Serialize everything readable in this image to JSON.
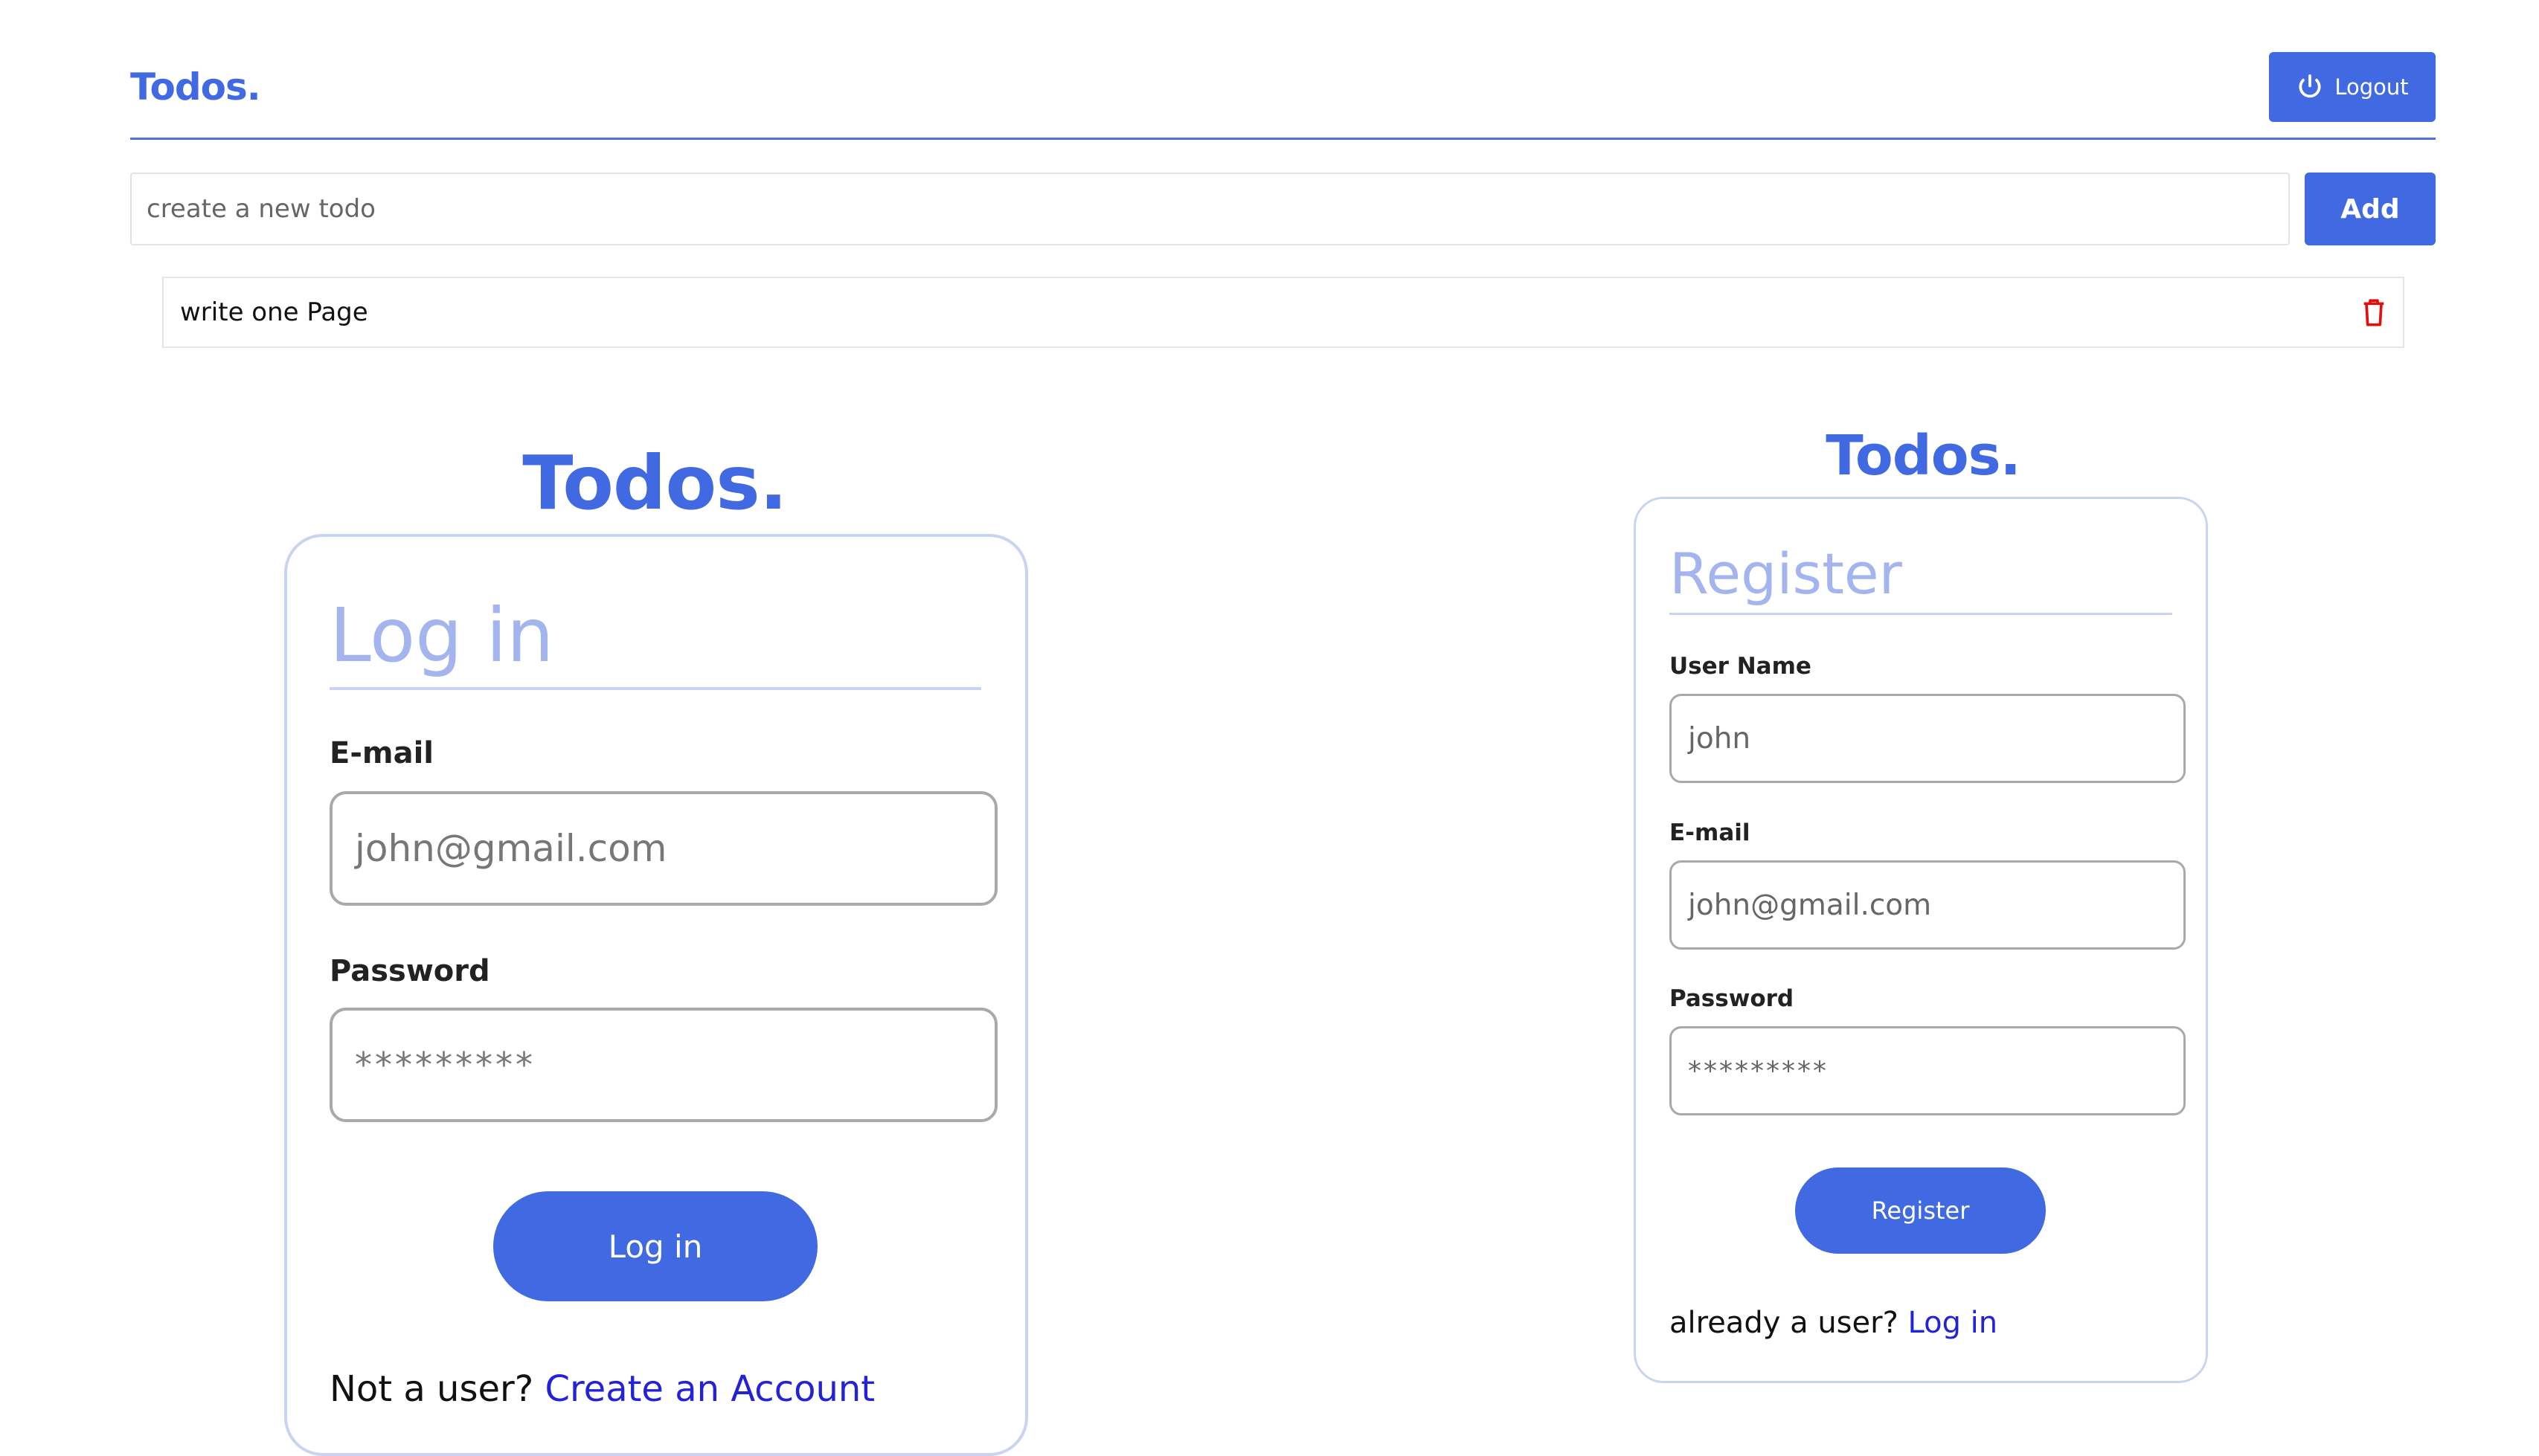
{
  "header": {
    "title": "Todos.",
    "logout_label": "Logout",
    "logout_icon": "power-icon"
  },
  "todo_form": {
    "placeholder": "create a new todo",
    "add_label": "Add"
  },
  "todos": [
    {
      "text": "write one Page",
      "delete_icon": "trash-icon"
    }
  ],
  "login": {
    "brand": "Todos.",
    "heading": "Log in",
    "email_label": "E-mail",
    "email_placeholder": "john@gmail.com",
    "password_label": "Password",
    "password_placeholder": "*********",
    "submit_label": "Log in",
    "footer_text": "Not a user?",
    "footer_link": "Create an Account"
  },
  "register": {
    "brand": "Todos.",
    "heading": "Register",
    "username_label": "User Name",
    "username_placeholder": "john",
    "email_label": "E-mail",
    "email_placeholder": "john@gmail.com",
    "password_label": "Password",
    "password_placeholder": "*********",
    "submit_label": "Register",
    "footer_text": "already a user?",
    "footer_link": "Log in"
  },
  "colors": {
    "accent": "#4169e1",
    "link": "#2222d8",
    "heading_muted": "#a3b4ee",
    "delete": "#e01010"
  }
}
